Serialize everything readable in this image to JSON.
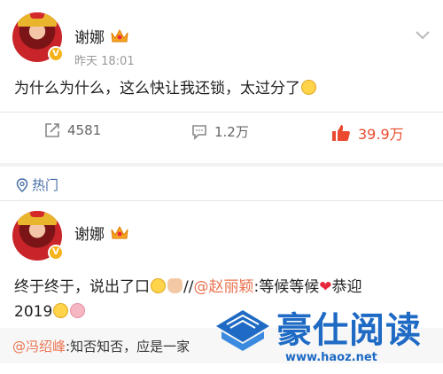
{
  "post1": {
    "author": "谢娜",
    "time": "昨天 18:01",
    "content": "为什么为什么，这么快让我还锁，太过分了",
    "reposts": "4581",
    "comments": "1.2万",
    "likes": "39.9万",
    "verified_badge": "V"
  },
  "hot_section": {
    "label": "热门"
  },
  "post2": {
    "author": "谢娜",
    "content_main": "终于终于，说出了口",
    "repost_sep": "//",
    "mention": "@赵丽颖",
    "content_rest": ":等候等候",
    "content_end": "恭迎",
    "content_year": "2019",
    "verified_badge": "V"
  },
  "comment": {
    "mention": "@冯绍峰",
    "text": ":知否知否，应是一家"
  },
  "watermark": {
    "title": "豪仕阅读",
    "url": "www.haoz.net"
  },
  "colors": {
    "accent_orange": "#eb7350",
    "like_red": "#eb4a2f",
    "hot_blue": "#4a6fa5",
    "watermark_blue": "#1e6ac4"
  }
}
